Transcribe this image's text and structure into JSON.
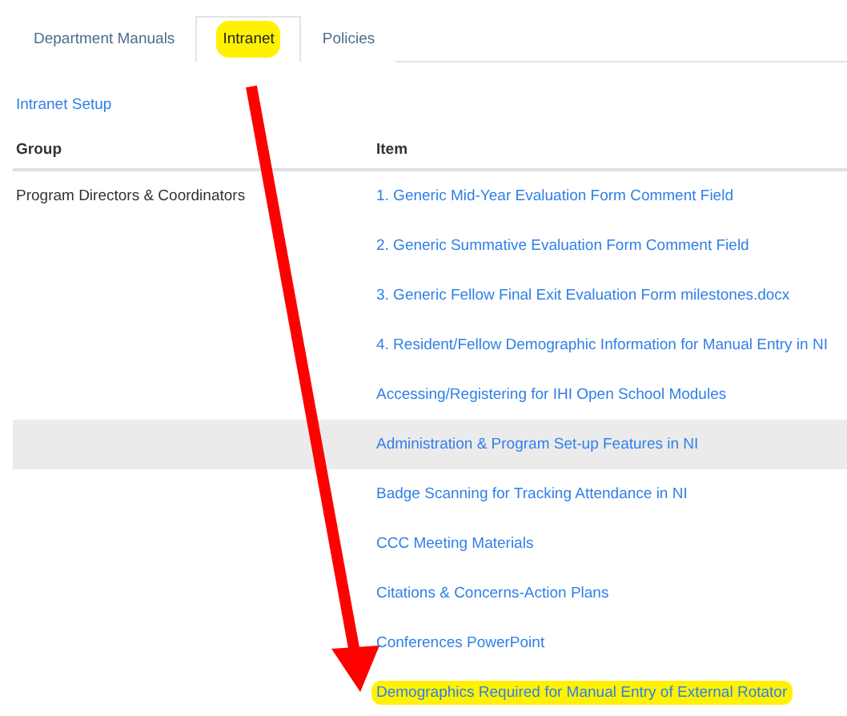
{
  "tabs": [
    {
      "label": "Department Manuals",
      "selected": false,
      "highlighted": false
    },
    {
      "label": "Intranet",
      "selected": true,
      "highlighted": true
    },
    {
      "label": "Policies",
      "selected": false,
      "highlighted": false
    }
  ],
  "setup_link": "Intranet Setup",
  "table": {
    "columns": [
      "Group",
      "Item"
    ],
    "rows": [
      {
        "group": "Program Directors & Coordinators",
        "item": "1. Generic Mid-Year Evaluation Form Comment Field",
        "hovered": false,
        "highlighted": false
      },
      {
        "item": "2. Generic Summative Evaluation Form Comment Field",
        "hovered": false,
        "highlighted": false
      },
      {
        "item": "3. Generic Fellow Final Exit Evaluation Form milestones.docx",
        "hovered": false,
        "highlighted": false
      },
      {
        "item": "4. Resident/Fellow Demographic Information for Manual Entry in NI",
        "hovered": false,
        "highlighted": false
      },
      {
        "item": "Accessing/Registering for IHI Open School Modules",
        "hovered": false,
        "highlighted": false
      },
      {
        "item": "Administration & Program Set-up Features in NI",
        "hovered": true,
        "highlighted": false
      },
      {
        "item": "Badge Scanning for Tracking Attendance in NI",
        "hovered": false,
        "highlighted": false
      },
      {
        "item": "CCC Meeting Materials",
        "hovered": false,
        "highlighted": false
      },
      {
        "item": "Citations & Concerns-Action Plans",
        "hovered": false,
        "highlighted": false
      },
      {
        "item": "Conferences PowerPoint",
        "hovered": false,
        "highlighted": false
      },
      {
        "item": "Demographics Required for Manual Entry of External Rotator",
        "hovered": false,
        "highlighted": true
      }
    ]
  }
}
